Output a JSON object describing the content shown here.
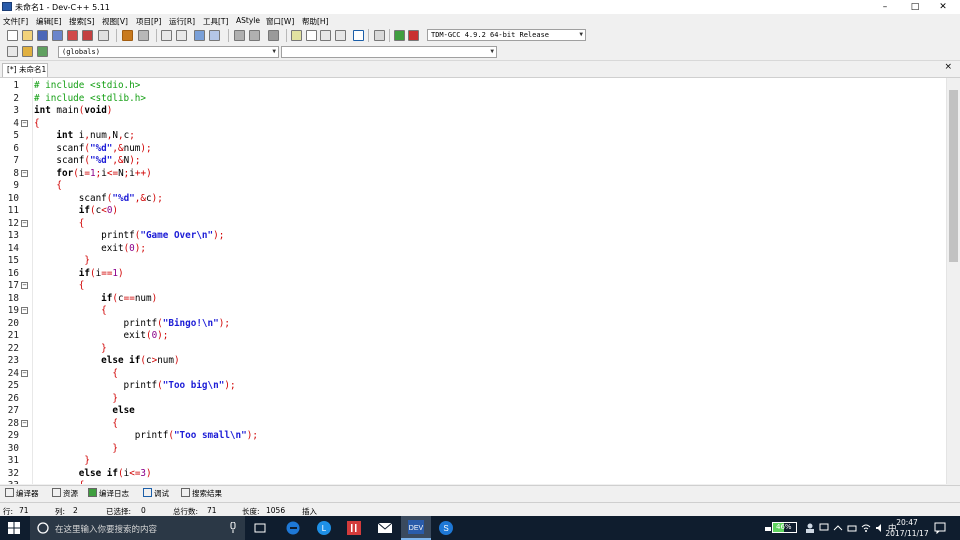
{
  "window": {
    "title": "未命名1 - Dev-C++ 5.11",
    "minimize": "–",
    "maximize": "□",
    "close": "✕"
  },
  "menu": [
    "文件[F]",
    "编辑[E]",
    "搜索[S]",
    "视图[V]",
    "项目[P]",
    "运行[R]",
    "工具[T]",
    "AStyle",
    "窗口[W]",
    "帮助[H]"
  ],
  "toolbar": {
    "compiler_select": "TDM-GCC 4.9.2 64-bit Release",
    "class_combo": "(globals)",
    "member_combo": ""
  },
  "editor": {
    "tab_label": "[*] 未命名1",
    "tab_close": "×",
    "lines": [
      "# include <stdio.h>",
      "# include <stdlib.h>",
      "int main(void)",
      "{",
      "    int i,num,N,c;",
      "    scanf(\"%d\",&num);",
      "    scanf(\"%d\",&N);",
      "    for(i=1;i<=N;i++)",
      "    {",
      "        scanf(\"%d\",&c);",
      "        if(c<0)",
      "        {",
      "            printf(\"Game Over\\n\");",
      "            exit(0);",
      "         }",
      "        if(i==1)",
      "        {",
      "            if(c==num)",
      "            {",
      "                printf(\"Bingo!\\n\");",
      "                exit(0);",
      "            }",
      "            else if(c>num)",
      "              {",
      "                printf(\"Too big\\n\");",
      "              }",
      "              else",
      "              {",
      "                  printf(\"Too small\\n\");",
      "              }",
      "         }",
      "        else if(i<=3)",
      "        {"
    ]
  },
  "bottom_tabs": [
    "编译器",
    "资源",
    "编译日志",
    "调试",
    "搜索结果"
  ],
  "status": {
    "row_label": "行:",
    "row": "71",
    "col_label": "列:",
    "col": "2",
    "sel_label": "已选择:",
    "sel": "0",
    "total_label": "总行数:",
    "total": "71",
    "length_label": "长度:",
    "length": "1056",
    "mode": "插入"
  },
  "taskbar": {
    "search_placeholder": "在这里输入你要搜索的内容",
    "battery": "46%",
    "ime": "中",
    "time": "20:47",
    "date": "2017/11/17"
  }
}
